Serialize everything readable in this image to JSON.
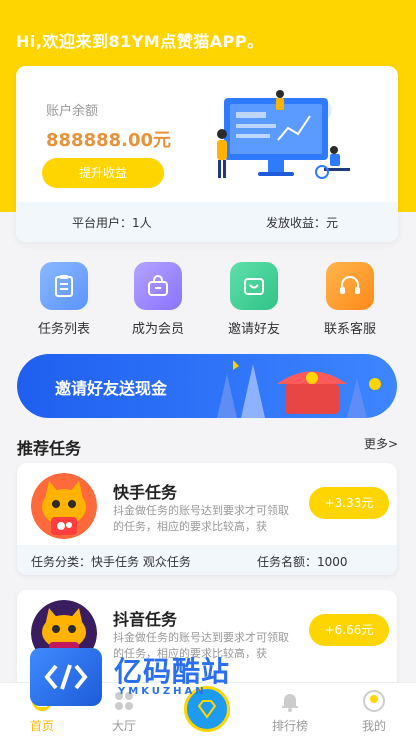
{
  "header": {
    "greeting": "Hi,欢迎来到81YM点赞猫APP。"
  },
  "balance": {
    "label": "账户余额",
    "amount": "888888.00元",
    "withdraw_label": "提升收益",
    "platform_users": "平台用户：1人",
    "payout": "发放收益：元"
  },
  "quick_actions": [
    {
      "label": "任务列表",
      "icon": "clipboard-icon",
      "color": "#6aa3ff"
    },
    {
      "label": "成为会员",
      "icon": "shopping-bag-icon",
      "color": "#9b86ff"
    },
    {
      "label": "邀请好友",
      "icon": "mail-icon",
      "color": "#3ecf94"
    },
    {
      "label": "联系客服",
      "icon": "headset-icon",
      "color": "#ff9a2e"
    }
  ],
  "banner": {
    "label": "邀请好友送现金"
  },
  "section": {
    "title": "推荐任务",
    "more": "更多>"
  },
  "tasks": [
    {
      "name": "快手任务",
      "desc": "抖金做任务的账号达到要求才可领取的任务，相应的要求比较高，获",
      "reward": "+3.33元",
      "category": "任务分类：快手任务 观众任务",
      "quota": "任务名额：1000",
      "avatar": "kuaishou-cat-avatar"
    },
    {
      "name": "抖音任务",
      "desc": "抖金做任务的账号达到要求才可领取的任务，相应的要求比较高，获",
      "reward": "+6.66元",
      "avatar": "douyin-cat-avatar"
    }
  ],
  "watermark": {
    "title": "亿码酷站",
    "subtitle": "YMKUZHAN"
  },
  "tabs": [
    {
      "label": "首页",
      "icon": "home-icon",
      "active": true
    },
    {
      "label": "大厅",
      "icon": "hall-icon",
      "active": false
    },
    {
      "label": "排行榜",
      "icon": "bell-icon",
      "active": false
    },
    {
      "label": "我的",
      "icon": "user-icon",
      "active": false
    }
  ],
  "colors": {
    "brand_yellow": "#ffd500",
    "accent_orange": "#e8933a",
    "banner_blue": "#1f5ff0",
    "tab_active": "#ffb800"
  }
}
